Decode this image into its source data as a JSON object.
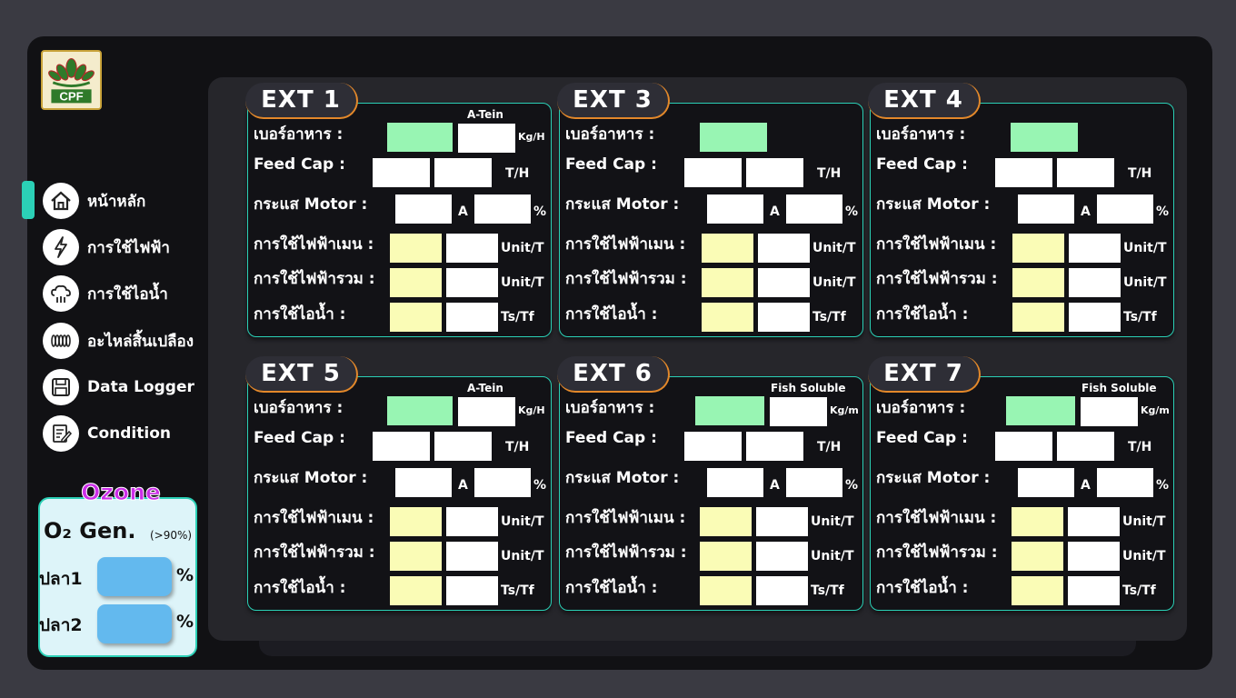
{
  "brand": {
    "logo_text": "CPF"
  },
  "sidebar": {
    "items": [
      {
        "label": "หน้าหลัก",
        "icon": "home-icon"
      },
      {
        "label": "การใช้ไฟฟ้า",
        "icon": "lightning-icon"
      },
      {
        "label": "การใช้ไอน้ำ",
        "icon": "steam-cloud-icon"
      },
      {
        "label": "อะไหล่สิ้นเปลือง",
        "icon": "spring-coil-icon"
      },
      {
        "label": "Data Logger",
        "icon": "floppy-disk-icon"
      },
      {
        "label": "Condition",
        "icon": "clipboard-edit-icon"
      }
    ]
  },
  "ozone": {
    "title": "Ozone",
    "o2_title": "O₂ Gen.",
    "o2_note": "(>90%)",
    "fish": [
      {
        "label": "ปลา1",
        "unit": "%"
      },
      {
        "label": "ปลา2",
        "unit": "%"
      }
    ]
  },
  "row_labels": {
    "feed_number": "เบอร์อาหาร :",
    "feed_cap": "Feed Cap :",
    "motor_current": "กระแส Motor :",
    "main_power": "การใช้ไฟฟ้าเมน :",
    "total_power": "การใช้ไฟฟ้ารวม :",
    "steam": "การใช้ไอน้ำ :"
  },
  "units": {
    "feed_cap": "T/H",
    "amp": "A",
    "percent": "%",
    "power": "Unit/T",
    "steam": "Ts/Tf"
  },
  "panels": [
    {
      "title": "EXT 1",
      "variant": "A-Tein",
      "feed_unit": "Kg/H"
    },
    {
      "title": "EXT 3",
      "variant": "",
      "feed_unit": ""
    },
    {
      "title": "EXT 4",
      "variant": "",
      "feed_unit": ""
    },
    {
      "title": "EXT 5",
      "variant": "A-Tein",
      "feed_unit": "Kg/H"
    },
    {
      "title": "EXT 6",
      "variant": "Fish Soluble",
      "feed_unit": "Kg/m"
    },
    {
      "title": "EXT 7",
      "variant": "Fish Soluble",
      "feed_unit": "Kg/m"
    }
  ],
  "colors": {
    "accent": "#2bd0b6",
    "tab_border": "#e3882a",
    "green_field": "#98f5b3",
    "yellow_field": "#fafcb6",
    "ozone_title": "#cc2ee8",
    "fish_value": "#63b9ee"
  }
}
